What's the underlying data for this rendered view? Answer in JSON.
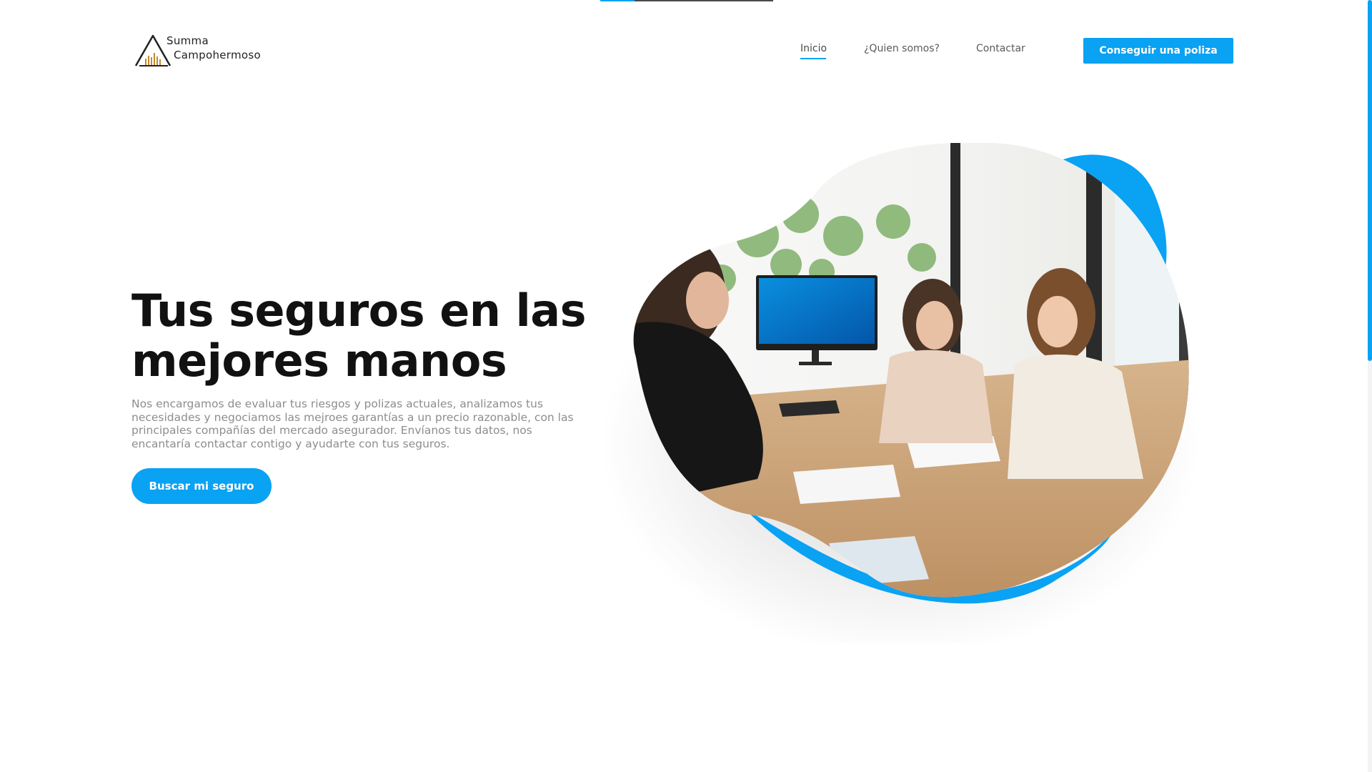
{
  "brand": {
    "name_line1": "Summa",
    "name_line2": "Campohermoso"
  },
  "nav": {
    "items": [
      {
        "label": "Inicio",
        "active": true
      },
      {
        "label": "¿Quien somos?",
        "active": false
      },
      {
        "label": "Contactar",
        "active": false
      }
    ],
    "cta_label": "Conseguir una poliza"
  },
  "hero": {
    "title_line1": "Tus seguros en las",
    "title_line2": "mejores manos",
    "description": "Nos encargamos de evaluar tus riesgos y polizas actuales, analizamos tus necesidades y negociamos las mejroes garantías a un precio razonable, con las principales compañías del mercado asegurador. Envíanos tus datos, nos encantaría contactar contigo y ayudarte con tus seguros.",
    "cta_label": "Buscar mi seguro",
    "image_subject": "office-meeting-photo"
  },
  "theme": {
    "accent": "#0aa2f3",
    "heading": "#111111",
    "body_text": "#8d8d8d"
  },
  "icons": {
    "logo": "mountain-bars-logo"
  }
}
